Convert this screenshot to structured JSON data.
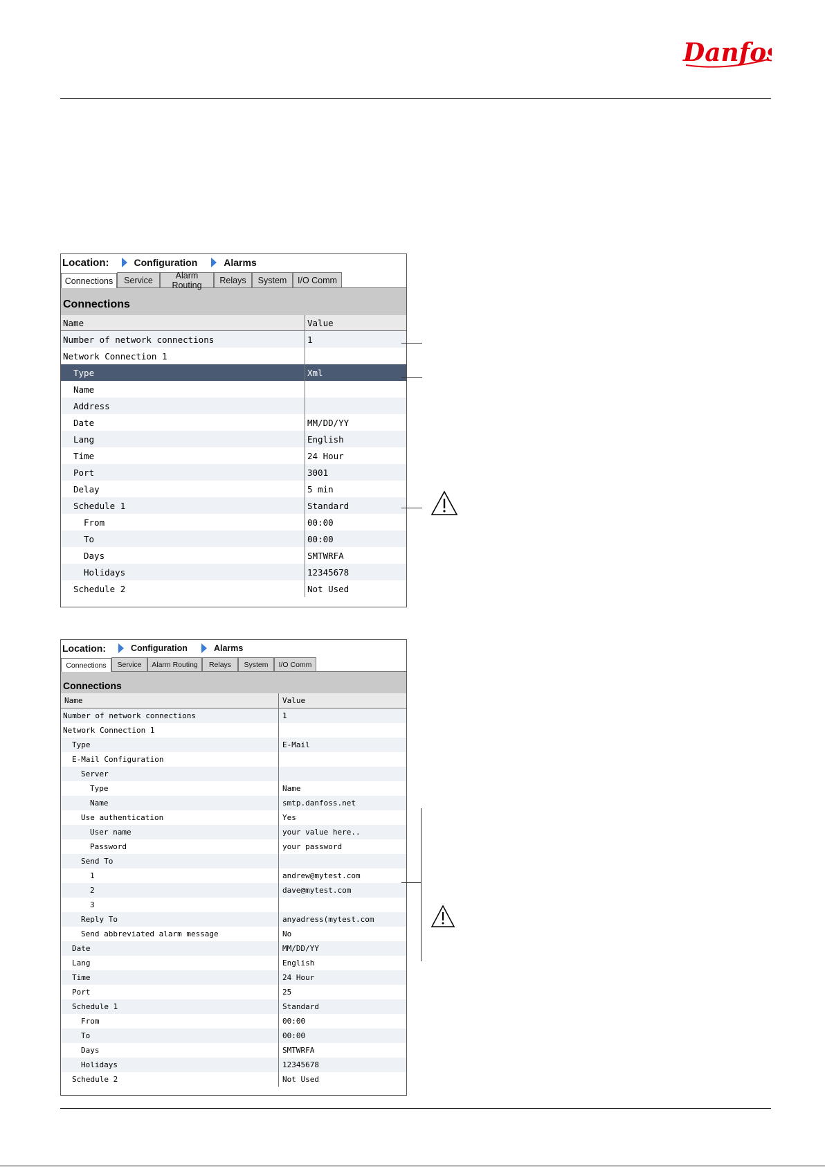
{
  "brand": {
    "logo_text": "Danfoss",
    "color": "#e2000f"
  },
  "panel1": {
    "location_label": "Location:",
    "breadcrumb": [
      "Configuration",
      "Alarms"
    ],
    "tabs": [
      {
        "label": "Connections",
        "active": true
      },
      {
        "label": "Service",
        "active": false
      },
      {
        "label": "Alarm Routing",
        "active": false
      },
      {
        "label": "Relays",
        "active": false
      },
      {
        "label": "System",
        "active": false
      },
      {
        "label": "I/O Comm",
        "active": false
      }
    ],
    "section_title": "Connections",
    "columns": [
      "Name",
      "Value"
    ],
    "rows": [
      {
        "name": "Number of network connections",
        "value": "1",
        "indent": 0
      },
      {
        "name": "Network Connection 1",
        "value": "",
        "indent": 0
      },
      {
        "name": "Type",
        "value": "Xml",
        "indent": 1,
        "selected": true
      },
      {
        "name": "Name",
        "value": "",
        "indent": 1
      },
      {
        "name": "Address",
        "value": "",
        "indent": 1
      },
      {
        "name": "Date",
        "value": "MM/DD/YY",
        "indent": 1
      },
      {
        "name": "Lang",
        "value": "English",
        "indent": 1
      },
      {
        "name": "Time",
        "value": "24 Hour",
        "indent": 1
      },
      {
        "name": "Port",
        "value": "3001",
        "indent": 1
      },
      {
        "name": "Delay",
        "value": "5 min",
        "indent": 1
      },
      {
        "name": "Schedule 1",
        "value": "Standard",
        "indent": 1
      },
      {
        "name": "From",
        "value": "00:00",
        "indent": 2
      },
      {
        "name": "To",
        "value": "00:00",
        "indent": 2
      },
      {
        "name": "Days",
        "value": "SMTWRFA",
        "indent": 2
      },
      {
        "name": "Holidays",
        "value": "12345678",
        "indent": 2
      },
      {
        "name": "Schedule 2",
        "value": "Not Used",
        "indent": 1
      }
    ]
  },
  "panel2": {
    "location_label": "Location:",
    "breadcrumb": [
      "Configuration",
      "Alarms"
    ],
    "tabs": [
      {
        "label": "Connections",
        "active": true
      },
      {
        "label": "Service",
        "active": false
      },
      {
        "label": "Alarm Routing",
        "active": false
      },
      {
        "label": "Relays",
        "active": false
      },
      {
        "label": "System",
        "active": false
      },
      {
        "label": "I/O Comm",
        "active": false
      }
    ],
    "section_title": "Connections",
    "columns": [
      "Name",
      "Value"
    ],
    "rows": [
      {
        "name": "Number of network connections",
        "value": "1",
        "indent": 0
      },
      {
        "name": "Network Connection 1",
        "value": "",
        "indent": 0
      },
      {
        "name": "Type",
        "value": "E-Mail",
        "indent": 1
      },
      {
        "name": "E-Mail Configuration",
        "value": "",
        "indent": 1
      },
      {
        "name": "Server",
        "value": "",
        "indent": 2
      },
      {
        "name": "Type",
        "value": "Name",
        "indent": 3
      },
      {
        "name": "Name",
        "value": "smtp.danfoss.net",
        "indent": 3
      },
      {
        "name": "Use authentication",
        "value": "Yes",
        "indent": 2
      },
      {
        "name": "User name",
        "value": "your value here..",
        "indent": 3
      },
      {
        "name": "Password",
        "value": "your password",
        "indent": 3
      },
      {
        "name": "Send To",
        "value": "",
        "indent": 2
      },
      {
        "name": "1",
        "value": "andrew@mytest.com",
        "indent": 3
      },
      {
        "name": "2",
        "value": "dave@mytest.com",
        "indent": 3
      },
      {
        "name": "3",
        "value": "",
        "indent": 3
      },
      {
        "name": "Reply To",
        "value": "anyadress(mytest.com",
        "indent": 2
      },
      {
        "name": "Send abbreviated alarm message",
        "value": "No",
        "indent": 2
      },
      {
        "name": "Date",
        "value": "MM/DD/YY",
        "indent": 1
      },
      {
        "name": "Lang",
        "value": "English",
        "indent": 1
      },
      {
        "name": "Time",
        "value": "24 Hour",
        "indent": 1
      },
      {
        "name": "Port",
        "value": "25",
        "indent": 1
      },
      {
        "name": "Schedule 1",
        "value": "Standard",
        "indent": 1
      },
      {
        "name": "From",
        "value": "00:00",
        "indent": 2
      },
      {
        "name": "To",
        "value": "00:00",
        "indent": 2
      },
      {
        "name": "Days",
        "value": "SMTWRFA",
        "indent": 2
      },
      {
        "name": "Holidays",
        "value": "12345678",
        "indent": 2
      },
      {
        "name": "Schedule 2",
        "value": "Not Used",
        "indent": 1
      }
    ]
  },
  "icons": {
    "breadcrumb_arrow": "triangle-right-icon",
    "warning": "warning-triangle-icon"
  },
  "colors": {
    "selected_row": "#4a5a72",
    "alt_row": "#eef2f6",
    "section_bg": "#c9c9c9",
    "arrow": "#3a7bd5"
  }
}
